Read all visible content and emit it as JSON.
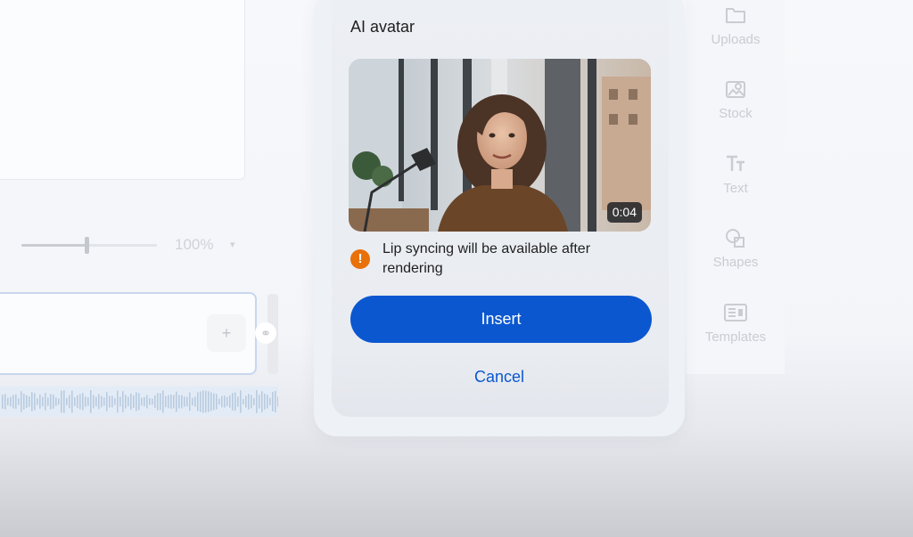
{
  "editor": {
    "zoom": {
      "value_label": "100%",
      "caret": "▾",
      "level": 0.48
    },
    "clip": {
      "add_label": "+"
    },
    "link_glyph": "⚭"
  },
  "rail": {
    "items": [
      {
        "label": "Uploads",
        "icon": "folder-icon"
      },
      {
        "label": "Stock",
        "icon": "stock-image-icon"
      },
      {
        "label": "Text",
        "icon": "text-icon"
      },
      {
        "label": "Shapes",
        "icon": "shapes-icon"
      },
      {
        "label": "Templates",
        "icon": "templates-icon"
      }
    ]
  },
  "dialog": {
    "title": "AI avatar",
    "video": {
      "duration": "0:04",
      "thumbnail_icon": "avatar-video-thumbnail"
    },
    "notice": {
      "icon": "warning-icon",
      "icon_glyph": "!",
      "text": "Lip syncing will be available after rendering"
    },
    "insert_label": "Insert",
    "cancel_label": "Cancel"
  },
  "colors": {
    "primary": "#0b57d0",
    "warning": "#e8710a",
    "surface": "#eceff4"
  }
}
